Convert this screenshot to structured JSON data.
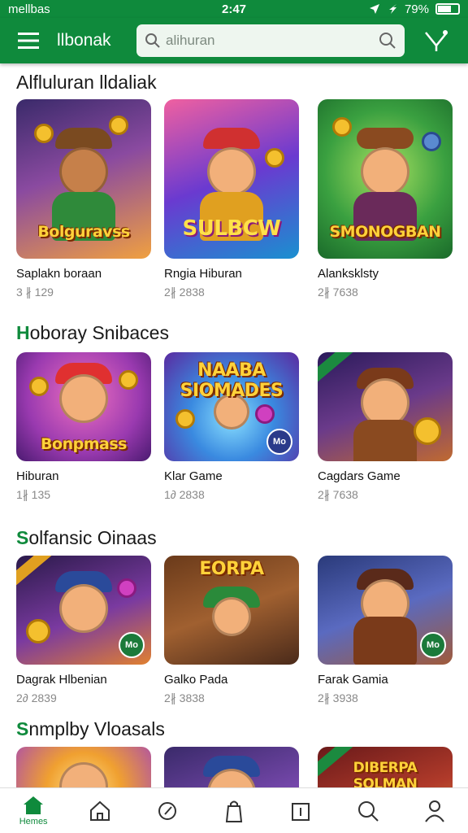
{
  "status": {
    "carrier": "mellbas",
    "time": "2:47",
    "battery": "79%"
  },
  "appbar": {
    "app_name": "llbonak",
    "search_placeholder": "alihuran",
    "menu_icon": "menu-icon",
    "filter_icon": "filter-icon"
  },
  "colors": {
    "brand": "#0f8a3c",
    "accent_green": "#1b8a3f"
  },
  "sections": [
    {
      "title_first": "A",
      "title_rest": "lfluluran lldaliak",
      "items": [
        {
          "name": "Saplakn boraan",
          "meta": "3 ∦  129",
          "art": "Bolguravss"
        },
        {
          "name": "Rngia Hiburan",
          "meta": "2∦  2838",
          "art": "SULBCW"
        },
        {
          "name": "Alanksklsty",
          "meta": "2∦  7638",
          "art": "SMONOGBAN"
        }
      ]
    },
    {
      "title_first": "H",
      "title_rest": "oboray Snibaces",
      "items": [
        {
          "name": "Hiburan",
          "meta": "1∦  135",
          "art": "Bonpmass"
        },
        {
          "name": "Klar Game",
          "meta": "1∂  2838",
          "art": "NAABA SIOMADES"
        },
        {
          "name": "Cagdars Game",
          "meta": "2∦  7638",
          "art": ""
        }
      ]
    },
    {
      "title_first": "S",
      "title_rest": "olfansic Oinaas",
      "items": [
        {
          "name": "Dagrak Hlbenian",
          "meta": "2∂  2839",
          "art": ""
        },
        {
          "name": "Galko Pada",
          "meta": "2∦  3838",
          "art": "EORPA"
        },
        {
          "name": "Farak Gamia",
          "meta": "2∦  3938",
          "art": ""
        }
      ]
    },
    {
      "title_first": "S",
      "title_rest": "nmplby Vloasals",
      "items": [
        {
          "name": "",
          "meta": "",
          "art": ""
        },
        {
          "name": "",
          "meta": "",
          "art": ""
        },
        {
          "name": "",
          "meta": "",
          "art": "DIBERPA SOLMAN"
        }
      ]
    }
  ],
  "nav": {
    "home_label": "Hemes"
  }
}
